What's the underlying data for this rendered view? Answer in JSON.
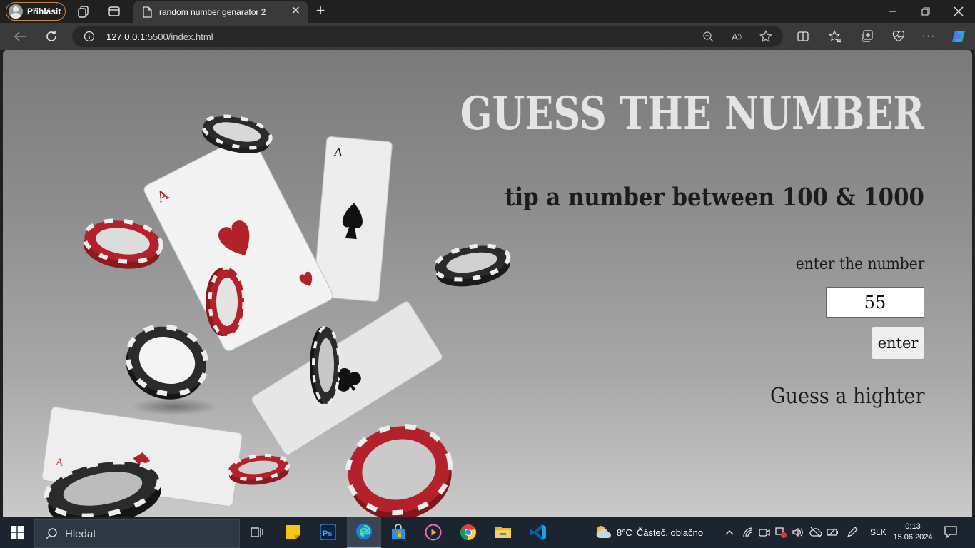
{
  "browser": {
    "profile_label": "Přihlásit",
    "tab_title": "random number genarator 2",
    "url_host": "127.0.0.1",
    "url_rest": ":5500/index.html"
  },
  "page": {
    "headline": "GUESS THE NUMBER",
    "subtitle": "tip a number between 100 & 1000",
    "input_label": "enter the number",
    "input_value": "55",
    "button_label": "enter",
    "result_text": "Guess a highter"
  },
  "taskbar": {
    "search_label": "Hledat",
    "weather_temp": "8°C",
    "weather_text": "Částeč. oblačno",
    "language": "SLK",
    "time": "0:13",
    "date": "15.06.2024"
  },
  "colors": {
    "browser_bg": "#202020",
    "toolbar_bg": "#3a3a3a",
    "chip_red": "#b3222a",
    "chip_black": "#1e1e1e",
    "taskbar_bg": "#1c2430"
  }
}
